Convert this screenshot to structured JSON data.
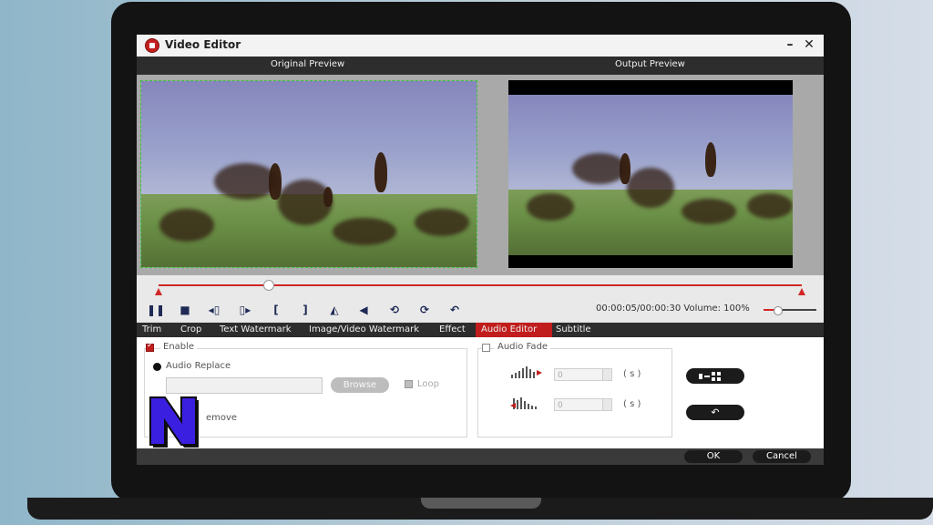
{
  "window": {
    "title": "Video Editor",
    "minimize_glyph": "–",
    "close_glyph": "✕",
    "app_icon": "video-editor-icon"
  },
  "preview": {
    "original_label": "Original Preview",
    "output_label": "Output Preview"
  },
  "playback": {
    "time": "00:00:05/00:00:30",
    "volume_label": "Volume:",
    "volume_value": "100%",
    "volume_level": 0.25,
    "seek_position": 0.17
  },
  "controls": [
    "pause-icon",
    "stop-icon",
    "prev-frame-icon",
    "next-frame-icon",
    "mark-in-icon",
    "mark-out-icon",
    "flip-horizontal-icon",
    "flip-vertical-icon",
    "rotate-left-icon",
    "rotate-right-icon",
    "undo-icon"
  ],
  "tabs": [
    {
      "label": "Trim",
      "active": false
    },
    {
      "label": "Crop",
      "active": false
    },
    {
      "label": "Text Watermark",
      "active": false
    },
    {
      "label": "Image/Video Watermark",
      "active": false
    },
    {
      "label": "Effect",
      "active": false
    },
    {
      "label": "Audio Editor",
      "active": true
    },
    {
      "label": "Subtitle",
      "active": false
    }
  ],
  "audio_editor": {
    "enable_label": "Enable",
    "enable_checked": true,
    "audio_replace_label": "Audio Replace",
    "browse_label": "Browse",
    "loop_label": "Loop",
    "remove_label": "emove",
    "audio_fade_label": "Audio Fade",
    "fade_in_value": "0",
    "fade_out_value": "0",
    "seconds_unit": "( s )",
    "reset_glyph": "↶"
  },
  "footer": {
    "ok_label": "OK",
    "cancel_label": "Cancel"
  },
  "colors": {
    "accent": "#c11d1d",
    "header_bg": "#2d2d2d",
    "logo_fill": "#3b1fe0"
  }
}
